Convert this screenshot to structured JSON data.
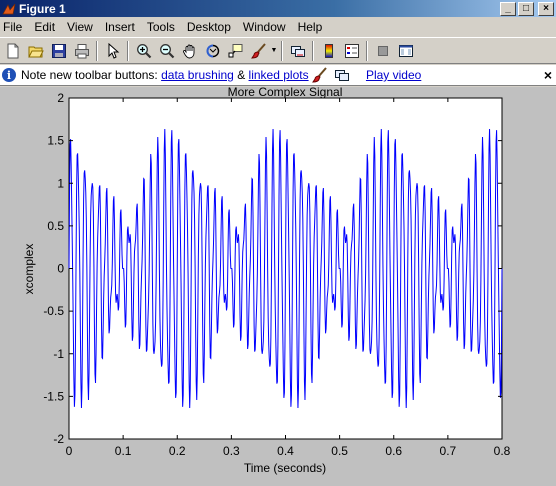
{
  "window": {
    "title": "Figure 1",
    "controls": {
      "minimize": "_",
      "maximize": "□",
      "close": "×"
    }
  },
  "menubar": {
    "items": [
      "File",
      "Edit",
      "View",
      "Insert",
      "Tools",
      "Desktop",
      "Window",
      "Help"
    ]
  },
  "toolbar": {
    "buttons": [
      "new-figure-icon",
      "open-file-icon",
      "save-icon",
      "print-icon",
      "edit-plot-arrow-icon",
      "zoom-in-icon",
      "zoom-out-icon",
      "pan-hand-icon",
      "rotate-3d-icon",
      "data-cursor-icon",
      "brush-icon",
      "link-plot-icon",
      "colorbar-icon",
      "legend-icon",
      "hide-plot-tools-icon",
      "show-plot-tools-icon"
    ]
  },
  "infobar": {
    "prefix": "Note new toolbar buttons:",
    "link1": "data brushing",
    "amp": "&",
    "link2": "linked plots",
    "video_link": "Play video",
    "close": "×"
  },
  "chart_data": {
    "type": "line",
    "title": "More Complex Signal",
    "xlabel": "Time (seconds)",
    "ylabel": "xcomplex",
    "xlim": [
      0,
      0.8
    ],
    "ylim": [
      -2,
      2
    ],
    "xticks": [
      "0",
      "0.1",
      "0.2",
      "0.3",
      "0.4",
      "0.5",
      "0.6",
      "0.7",
      "0.8"
    ],
    "yticks": [
      "2",
      "1.5",
      "1",
      "0.5",
      "0",
      "-0.5",
      "-1",
      "-1.5",
      "-2"
    ],
    "grid": false,
    "series": [
      {
        "color": "#0000ff",
        "components": [
          {
            "amplitude": 1.0,
            "frequency_hz": 75
          },
          {
            "amplitude": 0.5,
            "frequency_hz": 80
          },
          {
            "amplitude": 0.25,
            "frequency_hz": 160
          }
        ],
        "sample_rate_hz": 1000
      }
    ]
  },
  "colors": {
    "series": "#0000ff",
    "axes_bg": "#ffffff",
    "figure_bg": "#c0c0c0",
    "link": "#0000cc"
  }
}
